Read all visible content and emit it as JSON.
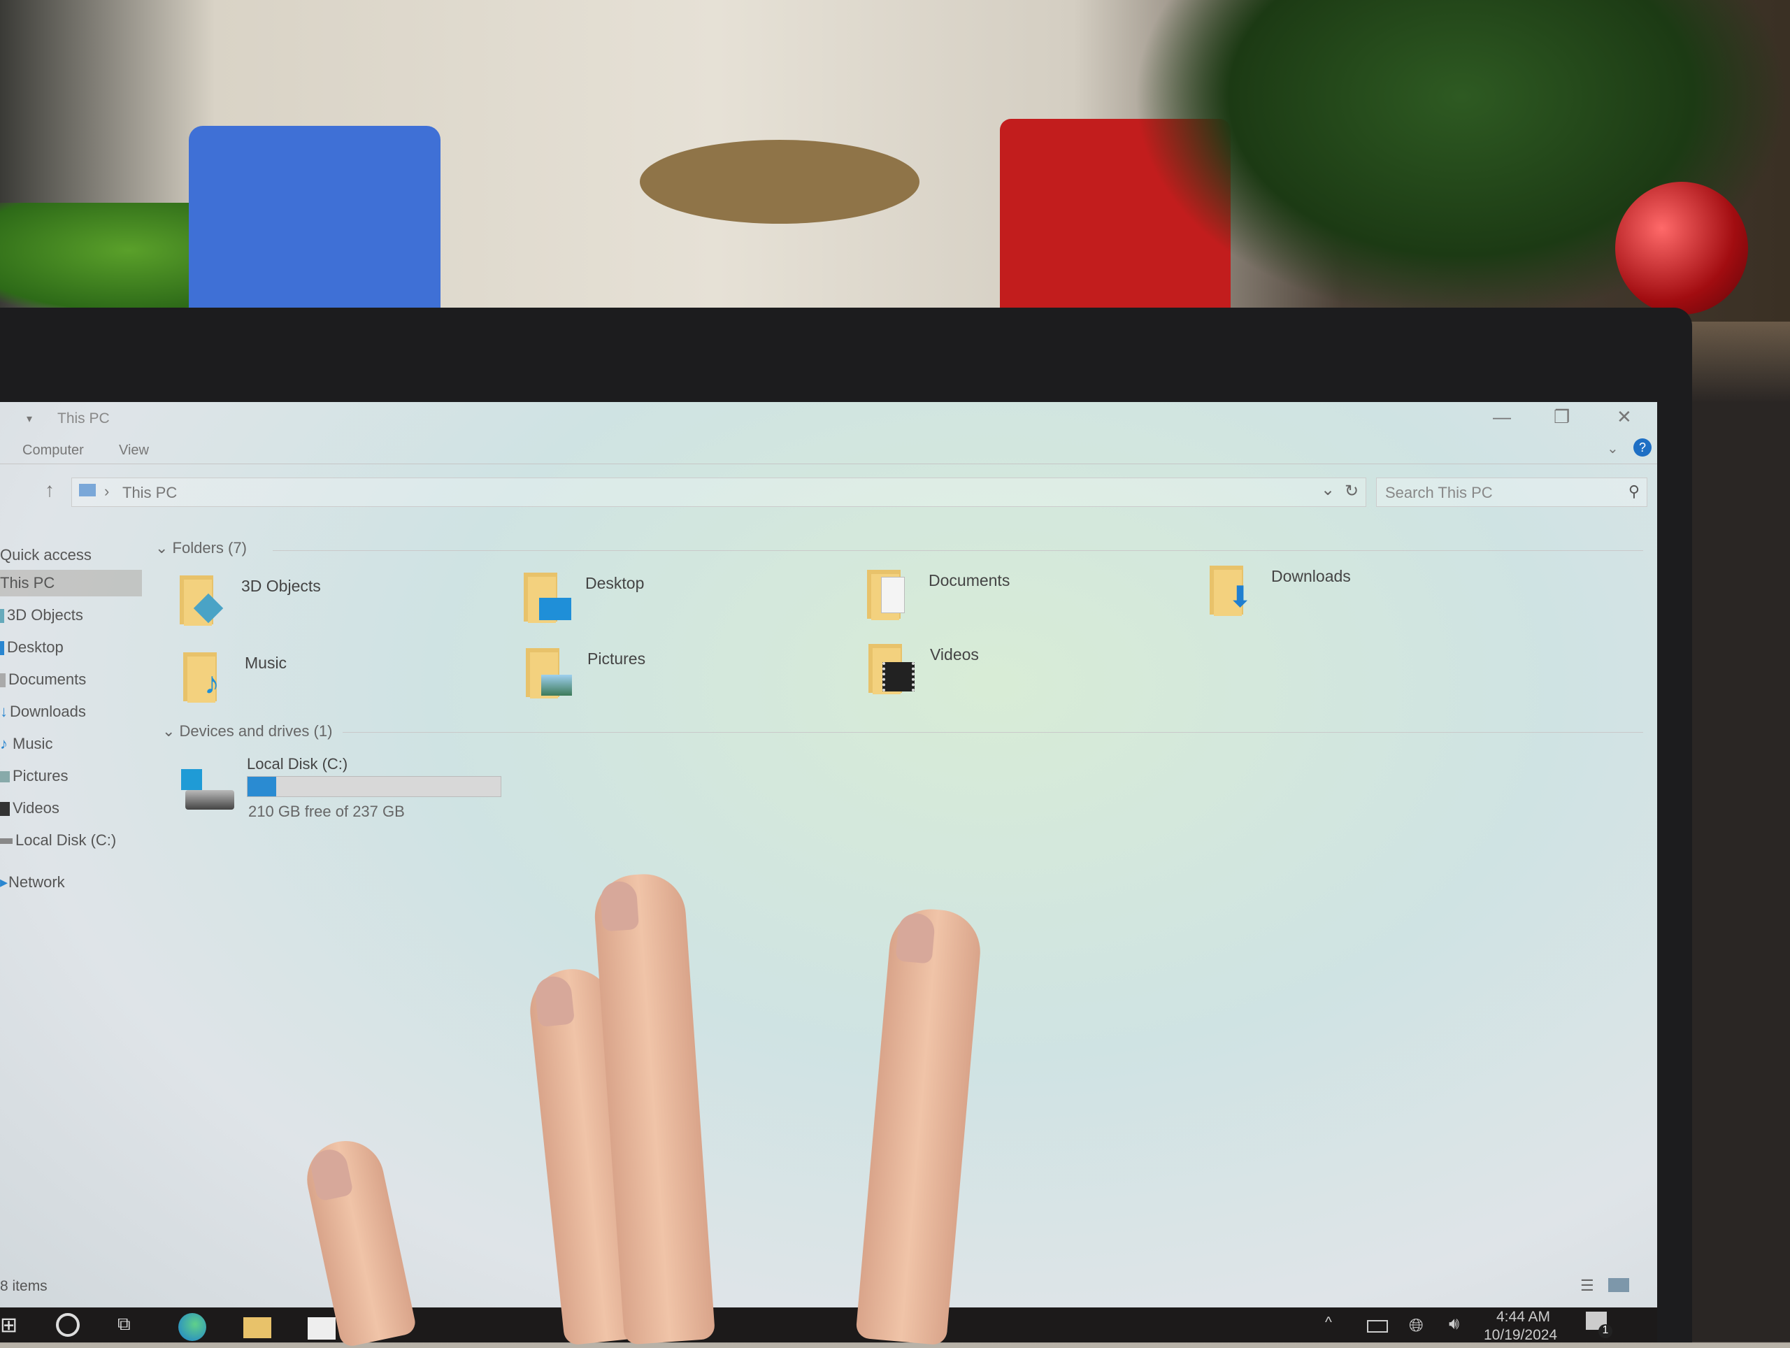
{
  "window": {
    "title": "This PC",
    "controls": {
      "minimize": "—",
      "restore": "❐",
      "close": "✕"
    },
    "help_glyph": "?"
  },
  "ribbon": {
    "tabs": [
      "Computer",
      "View"
    ]
  },
  "address_bar": {
    "breadcrumb": [
      "This PC"
    ],
    "separator": "›",
    "up_glyph": "↑",
    "dropdown_glyph": "⌄",
    "refresh_glyph": "↻"
  },
  "search": {
    "placeholder": "Search This PC",
    "icon": "search-icon"
  },
  "sidebar": {
    "items": [
      {
        "label": "Quick access",
        "icon": "star-icon",
        "selected": false
      },
      {
        "label": "This PC",
        "icon": "computer-icon",
        "selected": true
      },
      {
        "label": "3D Objects",
        "icon": "3d-objects-icon",
        "selected": false
      },
      {
        "label": "Desktop",
        "icon": "desktop-icon",
        "selected": false
      },
      {
        "label": "Documents",
        "icon": "documents-icon",
        "selected": false
      },
      {
        "label": "Downloads",
        "icon": "downloads-icon",
        "selected": false
      },
      {
        "label": "Music",
        "icon": "music-icon",
        "selected": false
      },
      {
        "label": "Pictures",
        "icon": "pictures-icon",
        "selected": false
      },
      {
        "label": "Videos",
        "icon": "videos-icon",
        "selected": false
      },
      {
        "label": "Local Disk (C:)",
        "icon": "drive-icon",
        "selected": false
      },
      {
        "label": "Network",
        "icon": "network-icon",
        "selected": false
      }
    ]
  },
  "folders_group": {
    "header": "Folders (7)",
    "items": [
      {
        "label": "3D Objects",
        "icon": "3d-objects-icon"
      },
      {
        "label": "Desktop",
        "icon": "desktop-icon"
      },
      {
        "label": "Documents",
        "icon": "documents-icon"
      },
      {
        "label": "Downloads",
        "icon": "downloads-icon"
      },
      {
        "label": "Music",
        "icon": "music-icon"
      },
      {
        "label": "Pictures",
        "icon": "pictures-icon"
      },
      {
        "label": "Videos",
        "icon": "videos-icon"
      }
    ]
  },
  "drives_group": {
    "header": "Devices and drives (1)",
    "drives": [
      {
        "label": "Local Disk (C:)",
        "free_text": "210 GB free of 237 GB",
        "used_fraction": 0.114,
        "bar_color": "#2a8bd2"
      }
    ]
  },
  "status_bar": {
    "items_text": "8 items"
  },
  "taskbar": {
    "apps": [
      "start-icon",
      "search-icon",
      "task-view-icon",
      "edge-icon",
      "file-explorer-icon",
      "store-icon"
    ],
    "tray": {
      "chevron": "^",
      "time": "4:44 AM",
      "date": "10/19/2024",
      "notification_count": "1"
    }
  }
}
